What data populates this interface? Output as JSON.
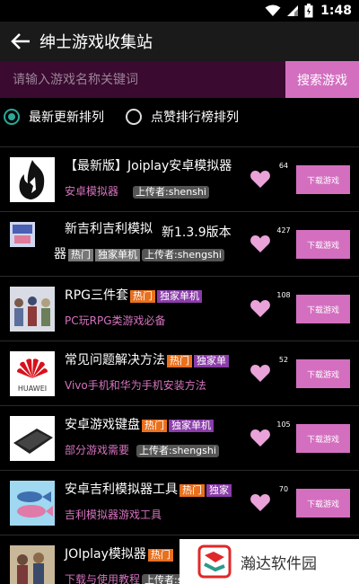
{
  "status_bar": {
    "time": "1:48"
  },
  "app_bar": {
    "title": "绅士游戏收集站"
  },
  "search": {
    "placeholder": "请输入游戏名称关键词",
    "button": "搜索游戏"
  },
  "sort": {
    "options": [
      {
        "label": "最新更新排列",
        "selected": true
      },
      {
        "label": "点赞排行榜排列",
        "selected": false
      }
    ]
  },
  "games": [
    {
      "name": "【最新版】Joiplay安卓模拟器",
      "desc": "安卓模拟器",
      "uploader": "上传者:shenshi",
      "likes": "64",
      "download": "下载游戏"
    },
    {
      "name_line1": "新吉利吉利模拟",
      "name_line1b": "新1.3.9版本",
      "name_line2": "器",
      "tag_hot": "热门",
      "tag_excl": "独家单机",
      "uploader": "上传者:shengshi",
      "likes": "427",
      "download": "下载游戏"
    },
    {
      "name": "RPG三件套",
      "tag_hot": "热门",
      "tag_excl": "独家单机",
      "desc": "PC玩RPG类游戏必备",
      "likes": "108",
      "download": "下载游戏"
    },
    {
      "name": "常见问题解决方法",
      "tag_hot": "热门",
      "tag_excl": "独家单",
      "desc": "Vivo手机和华为手机安装方法",
      "likes": "52",
      "download": "下载游戏"
    },
    {
      "name": "安卓游戏键盘",
      "tag_hot": "热门",
      "tag_excl": "独家单机",
      "desc": "部分游戏需要",
      "uploader": "上传者:shengshi",
      "likes": "105",
      "download": "下载游戏"
    },
    {
      "name": "安卓吉利模拟器工具",
      "tag_hot": "热门",
      "tag_excl": "独家",
      "desc": "吉利模拟器游戏工具",
      "likes": "70",
      "download": "下载游戏"
    },
    {
      "name": "JOIplay模拟器",
      "tag_hot": "热门",
      "desc": "下载与使用教程",
      "uploader": "上传者:s"
    }
  ],
  "thumb_labels": {
    "huawei": "HUAWEI"
  },
  "watermark": {
    "text": "瀚达软件园"
  },
  "colors": {
    "accent": "#d46fc0",
    "search_bg": "#3a0a30",
    "hot": "#e8701e",
    "exclusive": "#8a3ca8",
    "radio": "#2ba89a"
  }
}
